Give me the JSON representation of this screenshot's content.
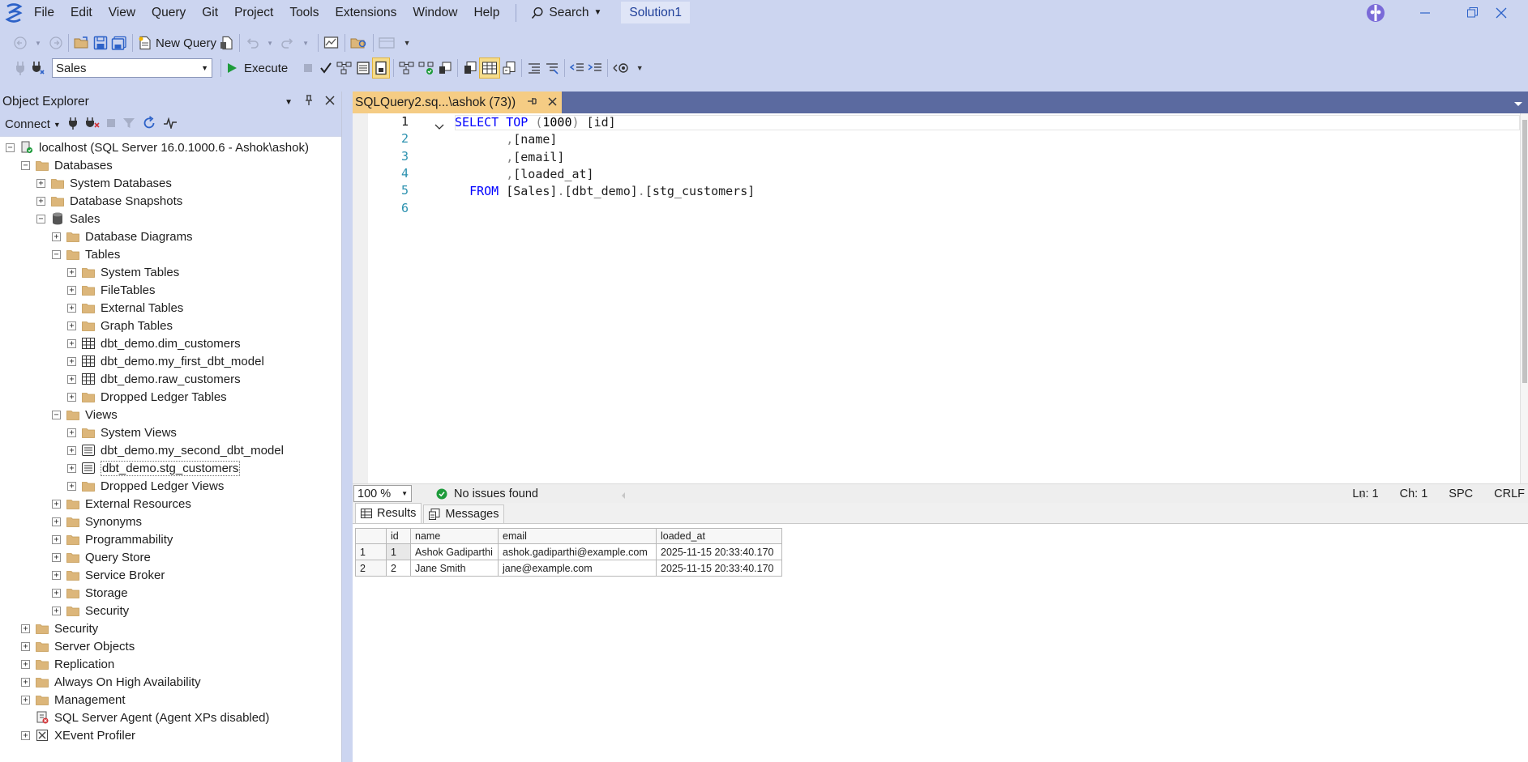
{
  "menubar": {
    "items": [
      "File",
      "Edit",
      "View",
      "Query",
      "Git",
      "Project",
      "Tools",
      "Extensions",
      "Window",
      "Help"
    ],
    "search_label": "Search",
    "solution": "Solution1"
  },
  "toolbar": {
    "new_query_label": "New Query",
    "database": "Sales",
    "execute_label": "Execute"
  },
  "object_explorer": {
    "title": "Object Explorer",
    "connect_label": "Connect",
    "nodes": [
      {
        "label": "localhost (SQL Server 16.0.1000.6 - Ashok\\ashok)",
        "level": 0,
        "expander": "minus",
        "icon": "server-icon"
      },
      {
        "label": "Databases",
        "level": 1,
        "expander": "minus",
        "icon": "folder-icon"
      },
      {
        "label": "System Databases",
        "level": 2,
        "expander": "plus",
        "icon": "folder-icon"
      },
      {
        "label": "Database Snapshots",
        "level": 2,
        "expander": "plus",
        "icon": "folder-icon"
      },
      {
        "label": "Sales",
        "level": 2,
        "expander": "minus",
        "icon": "database-icon"
      },
      {
        "label": "Database Diagrams",
        "level": 3,
        "expander": "plus",
        "icon": "folder-icon"
      },
      {
        "label": "Tables",
        "level": 3,
        "expander": "minus",
        "icon": "folder-icon"
      },
      {
        "label": "System Tables",
        "level": 4,
        "expander": "plus",
        "icon": "folder-icon"
      },
      {
        "label": "FileTables",
        "level": 4,
        "expander": "plus",
        "icon": "folder-icon"
      },
      {
        "label": "External Tables",
        "level": 4,
        "expander": "plus",
        "icon": "folder-icon"
      },
      {
        "label": "Graph Tables",
        "level": 4,
        "expander": "plus",
        "icon": "folder-icon"
      },
      {
        "label": "dbt_demo.dim_customers",
        "level": 4,
        "expander": "plus",
        "icon": "table-icon"
      },
      {
        "label": "dbt_demo.my_first_dbt_model",
        "level": 4,
        "expander": "plus",
        "icon": "table-icon"
      },
      {
        "label": "dbt_demo.raw_customers",
        "level": 4,
        "expander": "plus",
        "icon": "table-icon"
      },
      {
        "label": "Dropped Ledger Tables",
        "level": 4,
        "expander": "plus",
        "icon": "folder-icon"
      },
      {
        "label": "Views",
        "level": 3,
        "expander": "minus",
        "icon": "folder-icon"
      },
      {
        "label": "System Views",
        "level": 4,
        "expander": "plus",
        "icon": "folder-icon"
      },
      {
        "label": "dbt_demo.my_second_dbt_model",
        "level": 4,
        "expander": "plus",
        "icon": "view-icon"
      },
      {
        "label": "dbt_demo.stg_customers",
        "level": 4,
        "expander": "plus",
        "icon": "view-icon",
        "selected": true
      },
      {
        "label": "Dropped Ledger Views",
        "level": 4,
        "expander": "plus",
        "icon": "folder-icon"
      },
      {
        "label": "External Resources",
        "level": 3,
        "expander": "plus",
        "icon": "folder-icon"
      },
      {
        "label": "Synonyms",
        "level": 3,
        "expander": "plus",
        "icon": "folder-icon"
      },
      {
        "label": "Programmability",
        "level": 3,
        "expander": "plus",
        "icon": "folder-icon"
      },
      {
        "label": "Query Store",
        "level": 3,
        "expander": "plus",
        "icon": "folder-icon"
      },
      {
        "label": "Service Broker",
        "level": 3,
        "expander": "plus",
        "icon": "folder-icon"
      },
      {
        "label": "Storage",
        "level": 3,
        "expander": "plus",
        "icon": "folder-icon"
      },
      {
        "label": "Security",
        "level": 3,
        "expander": "plus",
        "icon": "folder-icon"
      },
      {
        "label": "Security",
        "level": 1,
        "expander": "plus",
        "icon": "folder-icon"
      },
      {
        "label": "Server Objects",
        "level": 1,
        "expander": "plus",
        "icon": "folder-icon"
      },
      {
        "label": "Replication",
        "level": 1,
        "expander": "plus",
        "icon": "folder-icon"
      },
      {
        "label": "Always On High Availability",
        "level": 1,
        "expander": "plus",
        "icon": "folder-icon"
      },
      {
        "label": "Management",
        "level": 1,
        "expander": "plus",
        "icon": "folder-icon"
      },
      {
        "label": "SQL Server Agent (Agent XPs disabled)",
        "level": 1,
        "expander": "none",
        "icon": "agent-icon"
      },
      {
        "label": "XEvent Profiler",
        "level": 1,
        "expander": "plus",
        "icon": "xevent-icon"
      }
    ]
  },
  "editor": {
    "tab_title": "SQLQuery2.sq...\\ashok (73))",
    "line_numbers": [
      "1",
      "2",
      "3",
      "4",
      "5",
      "6"
    ],
    "lines": [
      [
        {
          "t": "SELECT",
          "c": "kw"
        },
        {
          "t": " ",
          "c": ""
        },
        {
          "t": "TOP",
          "c": "kw"
        },
        {
          "t": " ",
          "c": ""
        },
        {
          "t": "(",
          "c": "punc"
        },
        {
          "t": "1000",
          "c": "num"
        },
        {
          "t": ")",
          "c": "punc"
        },
        {
          "t": " [id]",
          "c": ""
        }
      ],
      [
        {
          "t": "       ",
          "c": ""
        },
        {
          "t": ",",
          "c": "punc"
        },
        {
          "t": "[name]",
          "c": ""
        }
      ],
      [
        {
          "t": "       ",
          "c": ""
        },
        {
          "t": ",",
          "c": "punc"
        },
        {
          "t": "[email]",
          "c": ""
        }
      ],
      [
        {
          "t": "       ",
          "c": ""
        },
        {
          "t": ",",
          "c": "punc"
        },
        {
          "t": "[loaded_at]",
          "c": ""
        }
      ],
      [
        {
          "t": "  ",
          "c": ""
        },
        {
          "t": "FROM",
          "c": "kw"
        },
        {
          "t": " [Sales]",
          "c": ""
        },
        {
          "t": ".",
          "c": "punc"
        },
        {
          "t": "[dbt_demo]",
          "c": ""
        },
        {
          "t": ".",
          "c": "punc"
        },
        {
          "t": "[stg_customers]",
          "c": ""
        }
      ],
      []
    ]
  },
  "status": {
    "zoom": "100 %",
    "issues": "No issues found",
    "ln": "Ln: 1",
    "ch": "Ch: 1",
    "spc": "SPC",
    "crlf": "CRLF"
  },
  "results": {
    "tabs": [
      "Results",
      "Messages"
    ],
    "columns": [
      "id",
      "name",
      "email",
      "loaded_at"
    ],
    "rows": [
      {
        "n": "1",
        "cells": [
          "1",
          "Ashok Gadiparthi",
          "ashok.gadiparthi@example.com",
          "2025-11-15 20:33:40.170"
        ]
      },
      {
        "n": "2",
        "cells": [
          "2",
          "Jane Smith",
          "jane@example.com",
          "2025-11-15 20:33:40.170"
        ]
      }
    ]
  },
  "colors": {
    "chrome": "#ccd5f0",
    "tab_active": "#f5cc84",
    "tab_strip": "#5b6aa0",
    "keyword": "#0000ff",
    "line_number": "#2b91af",
    "folder": "#dcb67a"
  }
}
